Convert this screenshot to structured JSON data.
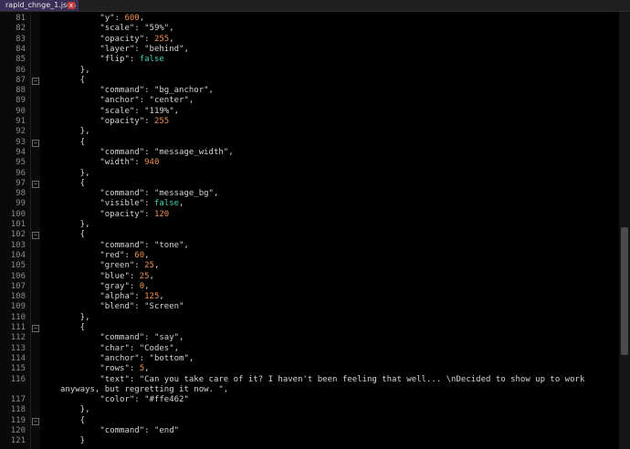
{
  "tab": {
    "label": "rapid_chnge_1.json",
    "close": "x"
  },
  "lines": [
    {
      "n": "81",
      "parts": [
        [
          "k",
          "        \"y\": "
        ],
        [
          "n",
          "600"
        ],
        [
          "k",
          ","
        ]
      ]
    },
    {
      "n": "82",
      "parts": [
        [
          "k",
          "        \"scale\": \"59%\","
        ]
      ]
    },
    {
      "n": "83",
      "parts": [
        [
          "k",
          "        \"opacity\": "
        ],
        [
          "n",
          "255"
        ],
        [
          "k",
          ","
        ]
      ]
    },
    {
      "n": "84",
      "parts": [
        [
          "k",
          "        \"layer\": \"behind\","
        ]
      ]
    },
    {
      "n": "85",
      "parts": [
        [
          "k",
          "        \"flip\": "
        ],
        [
          "b",
          "false"
        ]
      ]
    },
    {
      "n": "86",
      "parts": [
        [
          "k",
          "    },"
        ]
      ]
    },
    {
      "n": "87",
      "fold": true,
      "parts": [
        [
          "k",
          "    {"
        ]
      ]
    },
    {
      "n": "88",
      "parts": [
        [
          "k",
          "        \"command\": \"bg_anchor\","
        ]
      ]
    },
    {
      "n": "89",
      "parts": [
        [
          "k",
          "        \"anchor\": \"center\","
        ]
      ]
    },
    {
      "n": "90",
      "parts": [
        [
          "k",
          "        \"scale\": \"119%\","
        ]
      ]
    },
    {
      "n": "91",
      "parts": [
        [
          "k",
          "        \"opacity\": "
        ],
        [
          "n",
          "255"
        ]
      ]
    },
    {
      "n": "92",
      "parts": [
        [
          "k",
          "    },"
        ]
      ]
    },
    {
      "n": "93",
      "fold": true,
      "parts": [
        [
          "k",
          "    {"
        ]
      ]
    },
    {
      "n": "94",
      "parts": [
        [
          "k",
          "        \"command\": \"message_width\","
        ]
      ]
    },
    {
      "n": "95",
      "parts": [
        [
          "k",
          "        \"width\": "
        ],
        [
          "n",
          "940"
        ]
      ]
    },
    {
      "n": "96",
      "parts": [
        [
          "k",
          "    },"
        ]
      ]
    },
    {
      "n": "97",
      "fold": true,
      "parts": [
        [
          "k",
          "    {"
        ]
      ]
    },
    {
      "n": "98",
      "parts": [
        [
          "k",
          "        \"command\": \"message_bg\","
        ]
      ]
    },
    {
      "n": "99",
      "parts": [
        [
          "k",
          "        \"visible\": "
        ],
        [
          "b",
          "false"
        ],
        [
          "k",
          ","
        ]
      ]
    },
    {
      "n": "100",
      "parts": [
        [
          "k",
          "        \"opacity\": "
        ],
        [
          "n",
          "120"
        ]
      ]
    },
    {
      "n": "101",
      "parts": [
        [
          "k",
          "    },"
        ]
      ]
    },
    {
      "n": "102",
      "fold": true,
      "parts": [
        [
          "k",
          "    {"
        ]
      ]
    },
    {
      "n": "103",
      "parts": [
        [
          "k",
          "        \"command\": \"tone\","
        ]
      ]
    },
    {
      "n": "104",
      "parts": [
        [
          "k",
          "        \"red\": "
        ],
        [
          "n",
          "60"
        ],
        [
          "k",
          ","
        ]
      ]
    },
    {
      "n": "105",
      "parts": [
        [
          "k",
          "        \"green\": "
        ],
        [
          "n",
          "25"
        ],
        [
          "k",
          ","
        ]
      ]
    },
    {
      "n": "106",
      "parts": [
        [
          "k",
          "        \"blue\": "
        ],
        [
          "n",
          "25"
        ],
        [
          "k",
          ","
        ]
      ]
    },
    {
      "n": "107",
      "parts": [
        [
          "k",
          "        \"gray\": "
        ],
        [
          "n",
          "0"
        ],
        [
          "k",
          ","
        ]
      ]
    },
    {
      "n": "108",
      "parts": [
        [
          "k",
          "        \"alpha\": "
        ],
        [
          "n",
          "125"
        ],
        [
          "k",
          ","
        ]
      ]
    },
    {
      "n": "109",
      "parts": [
        [
          "k",
          "        \"blend\": \"Screen\""
        ]
      ]
    },
    {
      "n": "110",
      "parts": [
        [
          "k",
          "    },"
        ]
      ]
    },
    {
      "n": "111",
      "fold": true,
      "parts": [
        [
          "k",
          "    {"
        ]
      ]
    },
    {
      "n": "112",
      "parts": [
        [
          "k",
          "        \"command\": \"say\","
        ]
      ]
    },
    {
      "n": "113",
      "parts": [
        [
          "k",
          "        \"char\": \"Codes\","
        ]
      ]
    },
    {
      "n": "114",
      "parts": [
        [
          "k",
          "        \"anchor\": \"bottom\","
        ]
      ]
    },
    {
      "n": "115",
      "parts": [
        [
          "k",
          "        \"rows\": "
        ],
        [
          "n",
          "5"
        ],
        [
          "k",
          ","
        ]
      ]
    },
    {
      "n": "116",
      "parts": [
        [
          "k",
          "        \"text\": \"Can you take care of it? I haven't been feeling that well... \\nDecided to show up to work"
        ]
      ]
    },
    {
      "n": "",
      "parts": [
        [
          "k",
          "anyways, but regretting it now. \","
        ]
      ]
    },
    {
      "n": "117",
      "parts": [
        [
          "k",
          "        \"color\": \"#ffe462\""
        ]
      ]
    },
    {
      "n": "118",
      "parts": [
        [
          "k",
          "    },"
        ]
      ]
    },
    {
      "n": "119",
      "fold": true,
      "parts": [
        [
          "k",
          "    {"
        ]
      ]
    },
    {
      "n": "120",
      "parts": [
        [
          "k",
          "        \"command\": \"end\""
        ]
      ]
    },
    {
      "n": "121",
      "parts": [
        [
          "k",
          "    }"
        ]
      ]
    }
  ]
}
